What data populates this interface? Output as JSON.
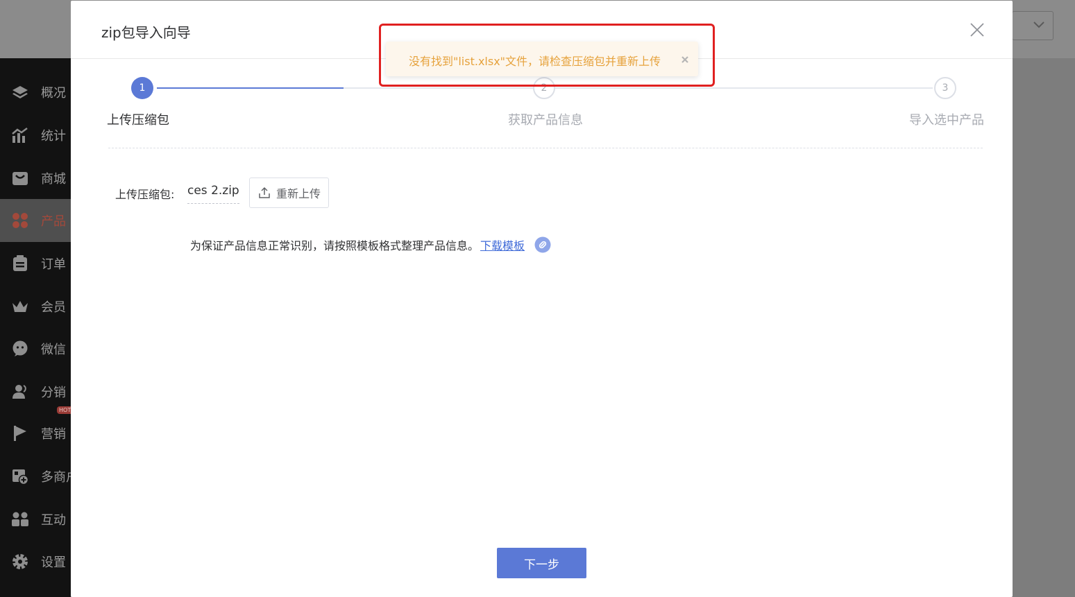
{
  "sidebar": {
    "items": [
      {
        "label": "概况",
        "icon": "layers-icon"
      },
      {
        "label": "统计",
        "icon": "chart-icon"
      },
      {
        "label": "商城",
        "icon": "shop-icon"
      },
      {
        "label": "产品",
        "icon": "grid-icon",
        "active": true
      },
      {
        "label": "订单",
        "icon": "order-icon"
      },
      {
        "label": "会员",
        "icon": "crown-icon"
      },
      {
        "label": "微信",
        "icon": "wechat-icon"
      },
      {
        "label": "分销",
        "icon": "users-icon"
      },
      {
        "label": "营销",
        "icon": "flag-icon",
        "badge": "HOT"
      },
      {
        "label": "多商户",
        "icon": "store-add-icon"
      },
      {
        "label": "互动",
        "icon": "group-icon"
      },
      {
        "label": "设置",
        "icon": "gear-icon"
      }
    ]
  },
  "modal": {
    "title": "zip包导入向导",
    "steps": [
      {
        "number": "1",
        "title": "上传压缩包"
      },
      {
        "number": "2",
        "title": "获取产品信息"
      },
      {
        "number": "3",
        "title": "导入选中产品"
      }
    ],
    "upload_label": "上传压缩包:",
    "file_name": "ces 2.zip",
    "reupload_label": "重新上传",
    "hint_text": "为保证产品信息正常识别，请按照模板格式整理产品信息。",
    "hint_link": "下载模板",
    "next_label": "下一步"
  },
  "toast": {
    "message": "没有找到\"list.xlsx\"文件，请检查压缩包并重新上传"
  },
  "colors": {
    "primary": "#5b79d6",
    "warning_text": "#e6a23c",
    "warning_bg": "#fdf6ec",
    "highlight": "#e02020"
  }
}
